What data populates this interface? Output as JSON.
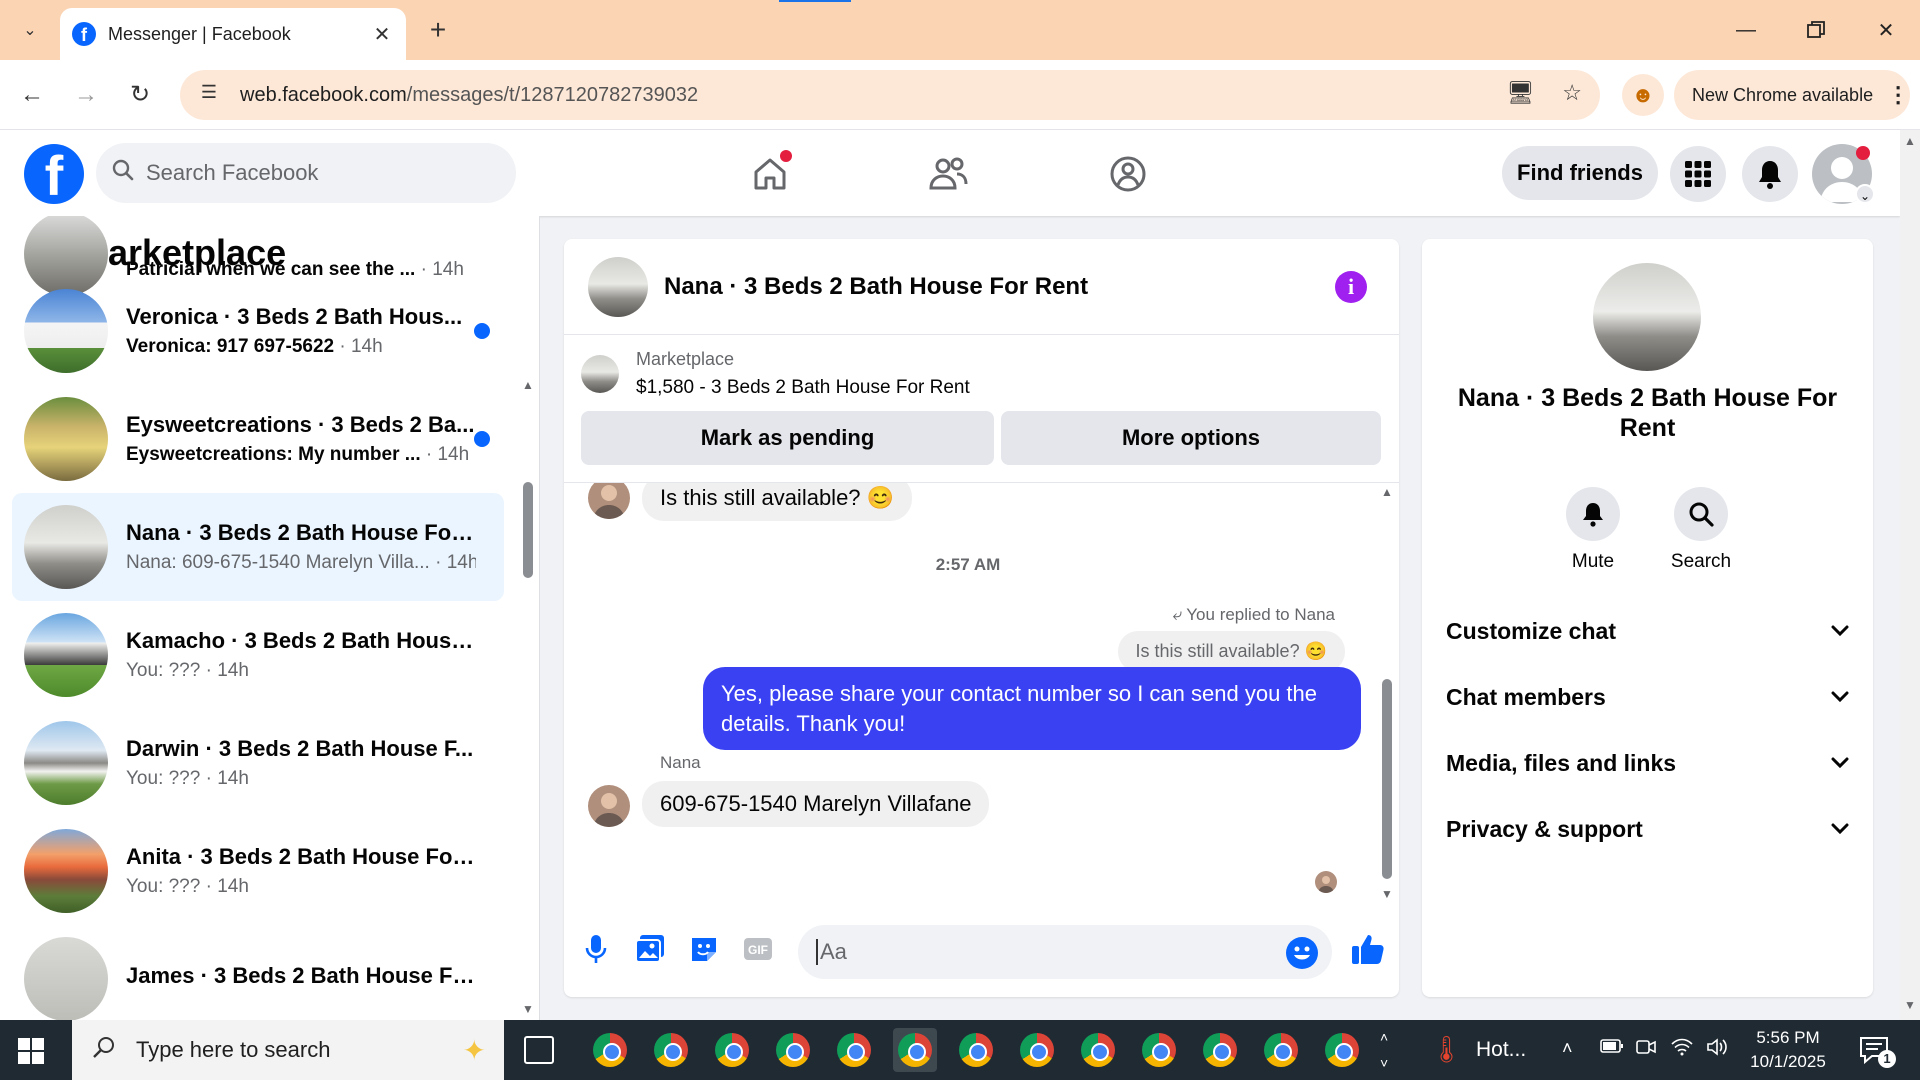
{
  "browser": {
    "tab_title": "Messenger | Facebook",
    "url_host": "web.facebook.com",
    "url_path": "/messages/t/1287120782739032",
    "update_label": "New Chrome available"
  },
  "facebook": {
    "search_placeholder": "Search Facebook",
    "find_friends_label": "Find friends"
  },
  "sidebar": {
    "title": "Marketplace",
    "conversations": [
      {
        "name": "",
        "preview": "Patricia: when we can see the ...",
        "time": "· 14h",
        "unread": true
      },
      {
        "name": "Veronica · 3 Beds 2 Bath Hous...",
        "preview": "Veronica: 917 697-5622",
        "time": "· 14h",
        "unread": true
      },
      {
        "name": "Eysweetcreations · 3 Beds 2 Ba...",
        "preview": "Eysweetcreations: My number ...",
        "time": "· 14h",
        "unread": true
      },
      {
        "name": "Nana · 3 Beds 2 Bath House For ...",
        "preview": "Nana: 609-675-1540 Marelyn Villa...",
        "time": "· 14h",
        "unread": false
      },
      {
        "name": "Kamacho · 3 Beds 2 Bath House ...",
        "preview": "You: ???",
        "time": "· 14h",
        "unread": false
      },
      {
        "name": "Darwin · 3 Beds 2 Bath House F...",
        "preview": "You: ???",
        "time": "· 14h",
        "unread": false
      },
      {
        "name": "Anita · 3 Beds 2 Bath House For ...",
        "preview": "You: ???",
        "time": "· 14h",
        "unread": false
      },
      {
        "name": "James · 3 Beds 2 Bath House For...",
        "preview": "",
        "time": "",
        "unread": false
      }
    ]
  },
  "chat": {
    "title": "Nana · 3 Beds 2 Bath House For Rent",
    "listing_label": "Marketplace",
    "listing_price": "$1,580 - 3 Beds 2 Bath House For Rent",
    "mark_pending_label": "Mark as pending",
    "more_options_label": "More options",
    "messages": {
      "incoming_1": "Is this still available? 😊",
      "timestamp": "2:57 AM",
      "replied_to": "You replied to Nana",
      "quoted": "Is this still available? 😊",
      "outgoing": "Yes, please share your contact number so I can send you the details. Thank you!",
      "sender_name": "Nana",
      "incoming_2": "609-675-1540 Marelyn Villafane"
    },
    "composer_placeholder": "Aa"
  },
  "info_panel": {
    "name": "Nana · 3 Beds 2 Bath House For Rent",
    "mute_label": "Mute",
    "search_label": "Search",
    "sections": [
      "Customize chat",
      "Chat members",
      "Media, files and links",
      "Privacy & support"
    ]
  },
  "taskbar": {
    "search_placeholder": "Type here to search",
    "weather": "Hot...",
    "time": "5:56 PM",
    "date": "10/1/2025",
    "notification_count": "1"
  },
  "colors": {
    "fb_blue": "#0866ff",
    "outgoing_bubble": "#3a41f3",
    "tab_strip": "#fbd4b4",
    "info_icon": "#a020f0"
  }
}
